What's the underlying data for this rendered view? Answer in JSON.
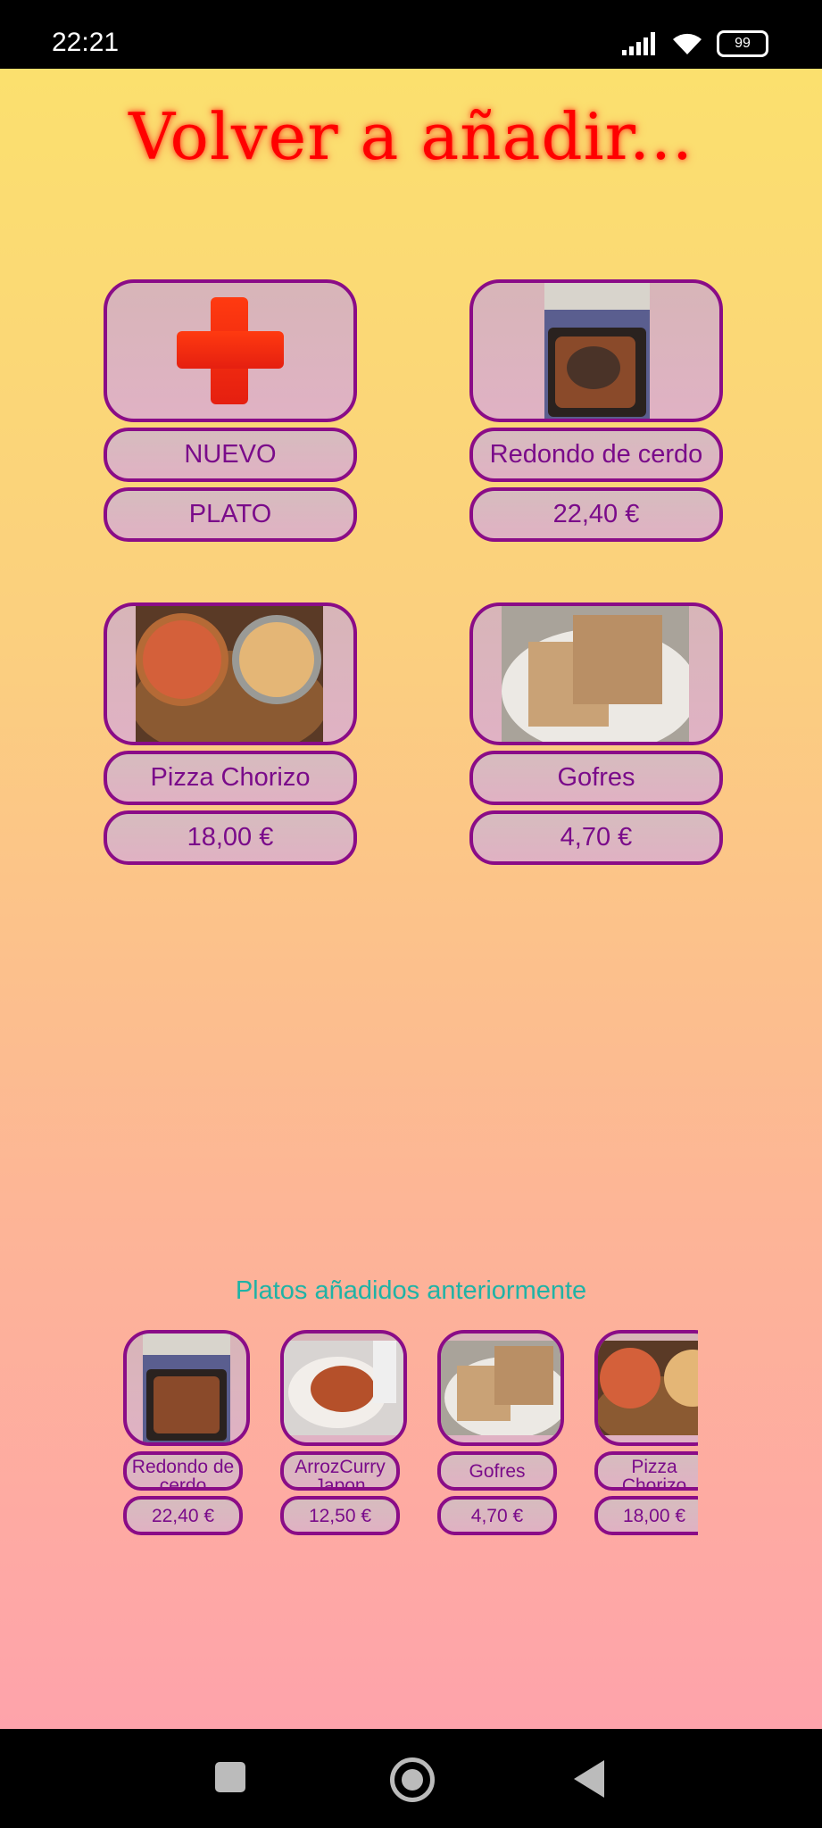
{
  "status_bar": {
    "time": "22:21",
    "battery": "99"
  },
  "title": "Volver a añadir...",
  "new_dish": {
    "line1": "NUEVO",
    "line2": "PLATO"
  },
  "dishes": [
    {
      "name": "Redondo de cerdo",
      "price": "22,40 €"
    },
    {
      "name": "Pizza Chorizo",
      "price": "18,00 €"
    },
    {
      "name": "Gofres",
      "price": "4,70 €"
    }
  ],
  "previous_section": {
    "label": "Platos añadidos anteriormente",
    "items": [
      {
        "name": "Redondo de cerdo",
        "price": "22,40 €"
      },
      {
        "name": "ArrozCurry Japon",
        "price": "12,50 €"
      },
      {
        "name": "Gofres",
        "price": "4,70 €"
      },
      {
        "name": "Pizza Chorizo",
        "price": "18,00 €"
      }
    ]
  },
  "colors": {
    "accent": "#8a0c87",
    "title": "#ff0000",
    "section_label": "#1fb3a6"
  },
  "icons": [
    "signal-icon",
    "wifi-icon",
    "battery-icon",
    "add-cross-icon",
    "nav-recents-icon",
    "nav-home-icon",
    "nav-back-icon"
  ]
}
